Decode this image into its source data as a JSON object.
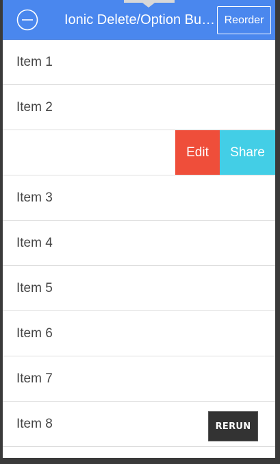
{
  "header": {
    "title": "Ionic Delete/Option Buttons",
    "reorder_label": "Reorder",
    "background_color": "#4a87ee",
    "delete_toggle_icon": "minus-circle-icon"
  },
  "list": {
    "items": [
      {
        "label": "Item 1"
      },
      {
        "label": "Item 2"
      },
      {
        "label": "Item 3"
      },
      {
        "label": "Item 4"
      },
      {
        "label": "Item 5"
      },
      {
        "label": "Item 6"
      },
      {
        "label": "Item 7"
      },
      {
        "label": "Item 8"
      }
    ],
    "swiped_item": {
      "edit_label": "Edit",
      "share_label": "Share",
      "edit_color": "#ef4e3a",
      "share_color": "#43cee6"
    }
  },
  "rerun": {
    "label": "RERUN"
  }
}
